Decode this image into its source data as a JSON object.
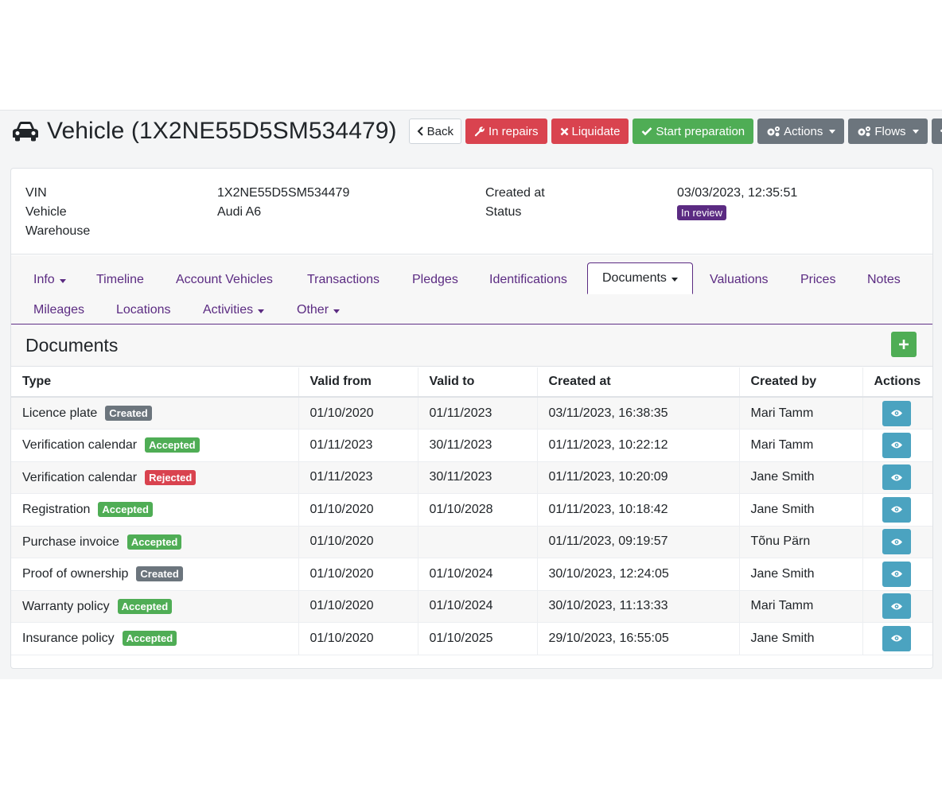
{
  "header": {
    "title": "Vehicle (1X2NE55D5SM534479)",
    "buttons": {
      "back": "Back",
      "in_repairs": "In repairs",
      "liquidate": "Liquidate",
      "start_preparation": "Start preparation",
      "actions": "Actions",
      "flows": "Flows",
      "more": "•••"
    }
  },
  "info": {
    "vin_label": "VIN",
    "vin_value": "1X2NE55D5SM534479",
    "vehicle_label": "Vehicle",
    "vehicle_value": "Audi A6",
    "warehouse_label": "Warehouse",
    "created_label": "Created at",
    "created_value": "03/03/2023, 12:35:51",
    "status_label": "Status",
    "status_value": "In review"
  },
  "tabs": {
    "info": "Info",
    "timeline": "Timeline",
    "account_vehicles": "Account Vehicles",
    "transactions": "Transactions",
    "pledges": "Pledges",
    "identifications": "Identifications",
    "documents": "Documents",
    "valuations": "Valuations",
    "prices": "Prices",
    "notes": "Notes",
    "mileages": "Mileages",
    "locations": "Locations",
    "activities": "Activities",
    "other": "Other"
  },
  "documents": {
    "title": "Documents",
    "add_label": "+",
    "columns": [
      "Type",
      "Valid from",
      "Valid to",
      "Created at",
      "Created by",
      "Actions"
    ],
    "rows": [
      {
        "type": "Licence plate",
        "status": "Created",
        "valid_from": "01/10/2020",
        "valid_to": "01/11/2023",
        "created_at": "03/11/2023, 16:38:35",
        "created_by": "Mari Tamm"
      },
      {
        "type": "Verification calendar",
        "status": "Accepted",
        "valid_from": "01/11/2023",
        "valid_to": "30/11/2023",
        "created_at": "01/11/2023, 10:22:12",
        "created_by": "Mari Tamm"
      },
      {
        "type": "Verification calendar",
        "status": "Rejected",
        "valid_from": "01/11/2023",
        "valid_to": "30/11/2023",
        "created_at": "01/11/2023, 10:20:09",
        "created_by": "Jane Smith"
      },
      {
        "type": "Registration",
        "status": "Accepted",
        "valid_from": "01/10/2020",
        "valid_to": "01/10/2028",
        "created_at": "01/11/2023, 10:18:42",
        "created_by": "Jane Smith"
      },
      {
        "type": "Purchase invoice",
        "status": "Accepted",
        "valid_from": "01/10/2020",
        "valid_to": "",
        "created_at": "01/11/2023, 09:19:57",
        "created_by": "Tõnu Pärn"
      },
      {
        "type": "Proof of ownership",
        "status": "Created",
        "valid_from": "01/10/2020",
        "valid_to": "01/10/2024",
        "created_at": "30/10/2023, 12:24:05",
        "created_by": "Jane Smith"
      },
      {
        "type": "Warranty policy",
        "status": "Accepted",
        "valid_from": "01/10/2020",
        "valid_to": "01/10/2024",
        "created_at": "30/10/2023, 11:13:33",
        "created_by": "Mari Tamm"
      },
      {
        "type": "Insurance policy",
        "status": "Accepted",
        "valid_from": "01/10/2020",
        "valid_to": "01/10/2025",
        "created_at": "29/10/2023, 16:55:05",
        "created_by": "Jane Smith"
      }
    ]
  },
  "colors": {
    "accent": "#5b2b82",
    "danger": "#d9434f",
    "success": "#4fad55",
    "secondary": "#6c757d",
    "info": "#4ba3c0"
  }
}
